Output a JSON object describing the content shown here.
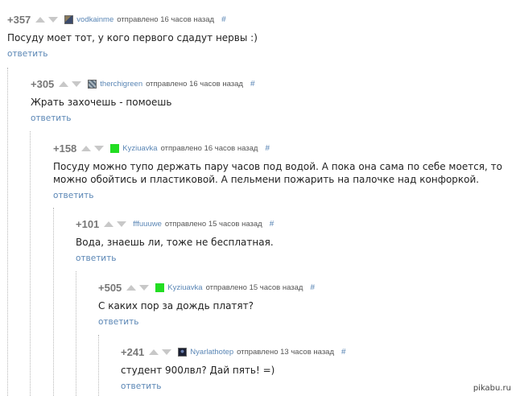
{
  "comments": [
    {
      "rating": "+357",
      "avatar": "avatar-dark-blue",
      "avatar_color": "#3b4a6b",
      "nick": "vodkainme",
      "meta": "отправлено 16 часов назад",
      "hash": "#",
      "lines": [
        "Посуду моет тот, у кого первого сдадут нервы :)"
      ],
      "reply": "ответить"
    },
    {
      "rating": "+305",
      "avatar": "avatar-striped",
      "avatar_color": "#5a6c7c",
      "nick": "therchigreen",
      "meta": "отправлено 16 часов назад",
      "hash": "#",
      "lines": [
        "Жрать захочешь - помоешь"
      ],
      "reply": "ответить"
    },
    {
      "rating": "+158",
      "avatar": "avatar-green-square",
      "avatar_color": "#22dd22",
      "nick": "Kyziuavka",
      "meta": "отправлено 16 часов назад",
      "hash": "#",
      "lines": [
        "Посуду можно тупо держать пару часов под водой. А пока она сама по себе моется, то",
        "можно обойтись и пластиковой. А пельмени пожарить на палочке над конфоркой."
      ],
      "reply": "ответить"
    },
    {
      "rating": "+101",
      "avatar": "",
      "avatar_color": "",
      "nick": "fffuuuwe",
      "meta": "отправлено 15 часов назад",
      "hash": "#",
      "lines": [
        "Вода, знаешь ли, тоже не бесплатная."
      ],
      "reply": "ответить"
    },
    {
      "rating": "+505",
      "avatar": "avatar-green-square",
      "avatar_color": "#22dd22",
      "nick": "Kyziuavka",
      "meta": "отправлено 15 часов назад",
      "hash": "#",
      "lines": [
        "С каких пор за дождь платят?"
      ],
      "reply": "ответить"
    },
    {
      "rating": "+241",
      "avatar": "avatar-dark-figure",
      "avatar_color": "#1a1f33",
      "nick": "Nyarlathotep",
      "meta": "отправлено 13 часов назад",
      "hash": "#",
      "lines": [
        "студент 900лвл? Дай пять! =)"
      ],
      "reply": "ответить"
    }
  ],
  "watermark": "pikabu.ru",
  "colors": {
    "link": "#5a86b5",
    "rating": "#777777",
    "arrow": "#c8c8c8",
    "text": "#222222"
  }
}
